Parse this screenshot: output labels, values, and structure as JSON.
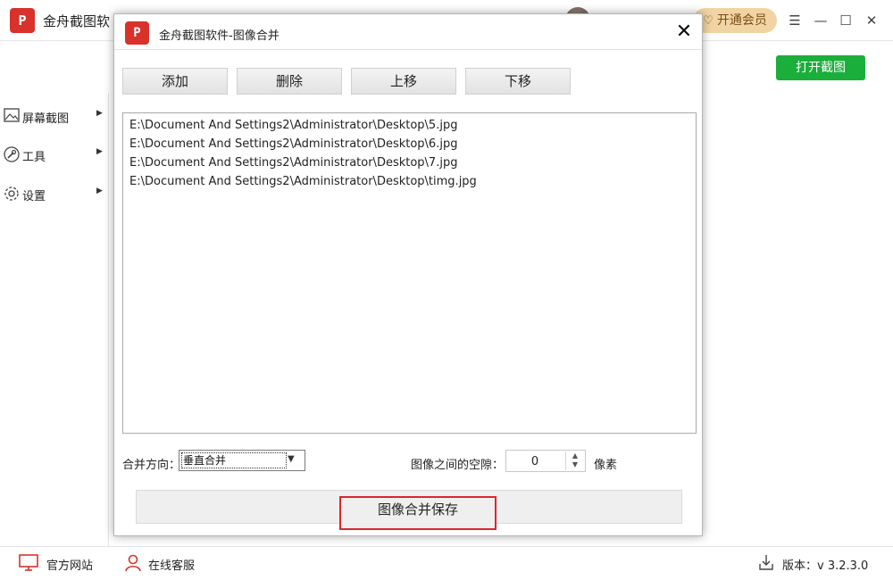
{
  "app": {
    "logo_text": "P",
    "title": "金舟截图软",
    "vip_label": "开通会员",
    "open_capture_label": "打开截图",
    "colors": {
      "brand_red": "#d8322b",
      "vip_gold": "#f1d4a3",
      "open_green": "#1aae3a"
    }
  },
  "sidebar": {
    "items": [
      {
        "label": "屏幕截图",
        "icon": "image-icon"
      },
      {
        "label": "工具",
        "icon": "wrench-icon"
      },
      {
        "label": "设置",
        "icon": "gear-icon"
      }
    ]
  },
  "footer": {
    "website_label": "官方网站",
    "support_label": "在线客服",
    "version_label": "版本：v 3.2.3.0"
  },
  "dialog": {
    "logo_text": "P",
    "title": "金舟截图软件-图像合并",
    "buttons": {
      "add": "添加",
      "delete": "删除",
      "move_up": "上移",
      "move_down": "下移"
    },
    "files": [
      "E:\\Document And Settings2\\Administrator\\Desktop\\5.jpg",
      "E:\\Document And Settings2\\Administrator\\Desktop\\6.jpg",
      "E:\\Document And Settings2\\Administrator\\Desktop\\7.jpg",
      "E:\\Document And Settings2\\Administrator\\Desktop\\timg.jpg"
    ],
    "direction_label": "合并方向：",
    "direction_value": "垂直合并",
    "gap_label": "图像之间的空隙：",
    "gap_value": "0",
    "unit_label": "像素",
    "save_label": "图像合并保存"
  }
}
